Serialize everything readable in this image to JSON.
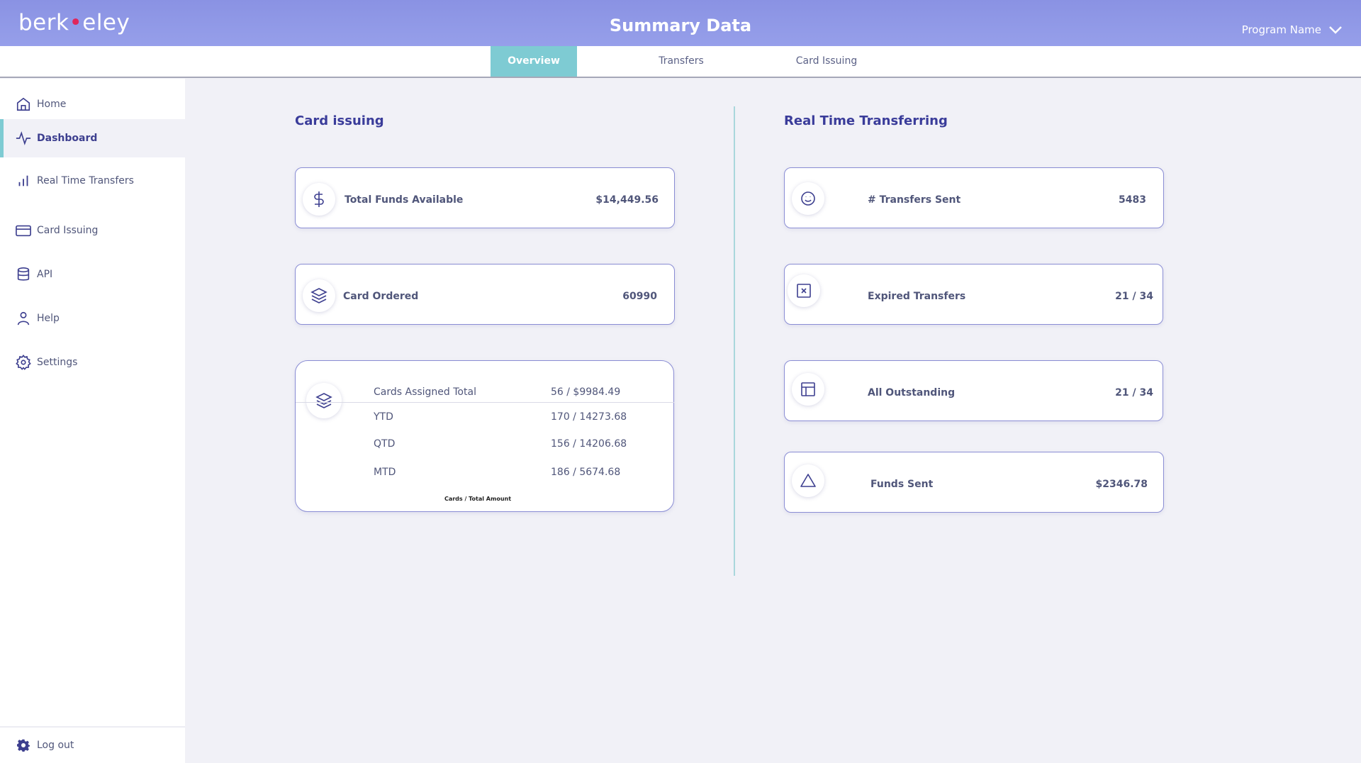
{
  "header": {
    "logo": {
      "pre": "berk",
      "dot": "•",
      "post": "eley"
    },
    "title": "Summary Data",
    "program_label": "Program Name"
  },
  "tabs": [
    {
      "label": "Overview",
      "active": true
    },
    {
      "label": "Transfers",
      "active": false
    },
    {
      "label": "Card Issuing",
      "active": false
    }
  ],
  "sidebar": {
    "items": [
      {
        "label": "Home",
        "icon": "home-icon"
      },
      {
        "label": "Dashboard",
        "icon": "activity-icon",
        "active": true
      },
      {
        "label": "Real Time Transfers",
        "icon": "bar-chart-icon"
      },
      {
        "label": "Card Issuing",
        "icon": "credit-card-icon"
      },
      {
        "label": "API",
        "icon": "database-icon"
      },
      {
        "label": "Help",
        "icon": "user-icon"
      },
      {
        "label": "Settings",
        "icon": "settings-icon"
      }
    ],
    "logout_label": "Log out"
  },
  "card_issuing": {
    "title": "Card issuing",
    "total_funds": {
      "label": "Total Funds Available",
      "value": "$14,449.56",
      "icon": "dollar-icon"
    },
    "card_ordered": {
      "label": "Card Ordered",
      "value": "60990",
      "icon": "layers-icon"
    },
    "assigned": {
      "icon": "layers-icon",
      "rows": [
        {
          "label": "Cards Assigned Total",
          "value": "56 / $9984.49"
        },
        {
          "label": "YTD",
          "value": "170 / 14273.68"
        },
        {
          "label": "QTD",
          "value": "156 / 14206.68"
        },
        {
          "label": "MTD",
          "value": "186 / 5674.68"
        }
      ],
      "footnote": "Cards / Total Amount"
    }
  },
  "real_time": {
    "title": "Real Time Transferring",
    "cards": [
      {
        "label": "# Transfers Sent",
        "value": "5483",
        "icon": "smile-icon"
      },
      {
        "label": "Expired Transfers",
        "value": "21 / 34",
        "icon": "x-square-icon"
      },
      {
        "label": "All Outstanding",
        "value": "21 / 34",
        "icon": "layout-icon"
      },
      {
        "label": "Funds Sent",
        "value": "$2346.78",
        "icon": "triangle-icon"
      }
    ]
  },
  "colors": {
    "header": "#8a92e3",
    "accent": "#7ecbd3",
    "title": "#3a3c9a",
    "card_border": "#8a8dd4"
  }
}
